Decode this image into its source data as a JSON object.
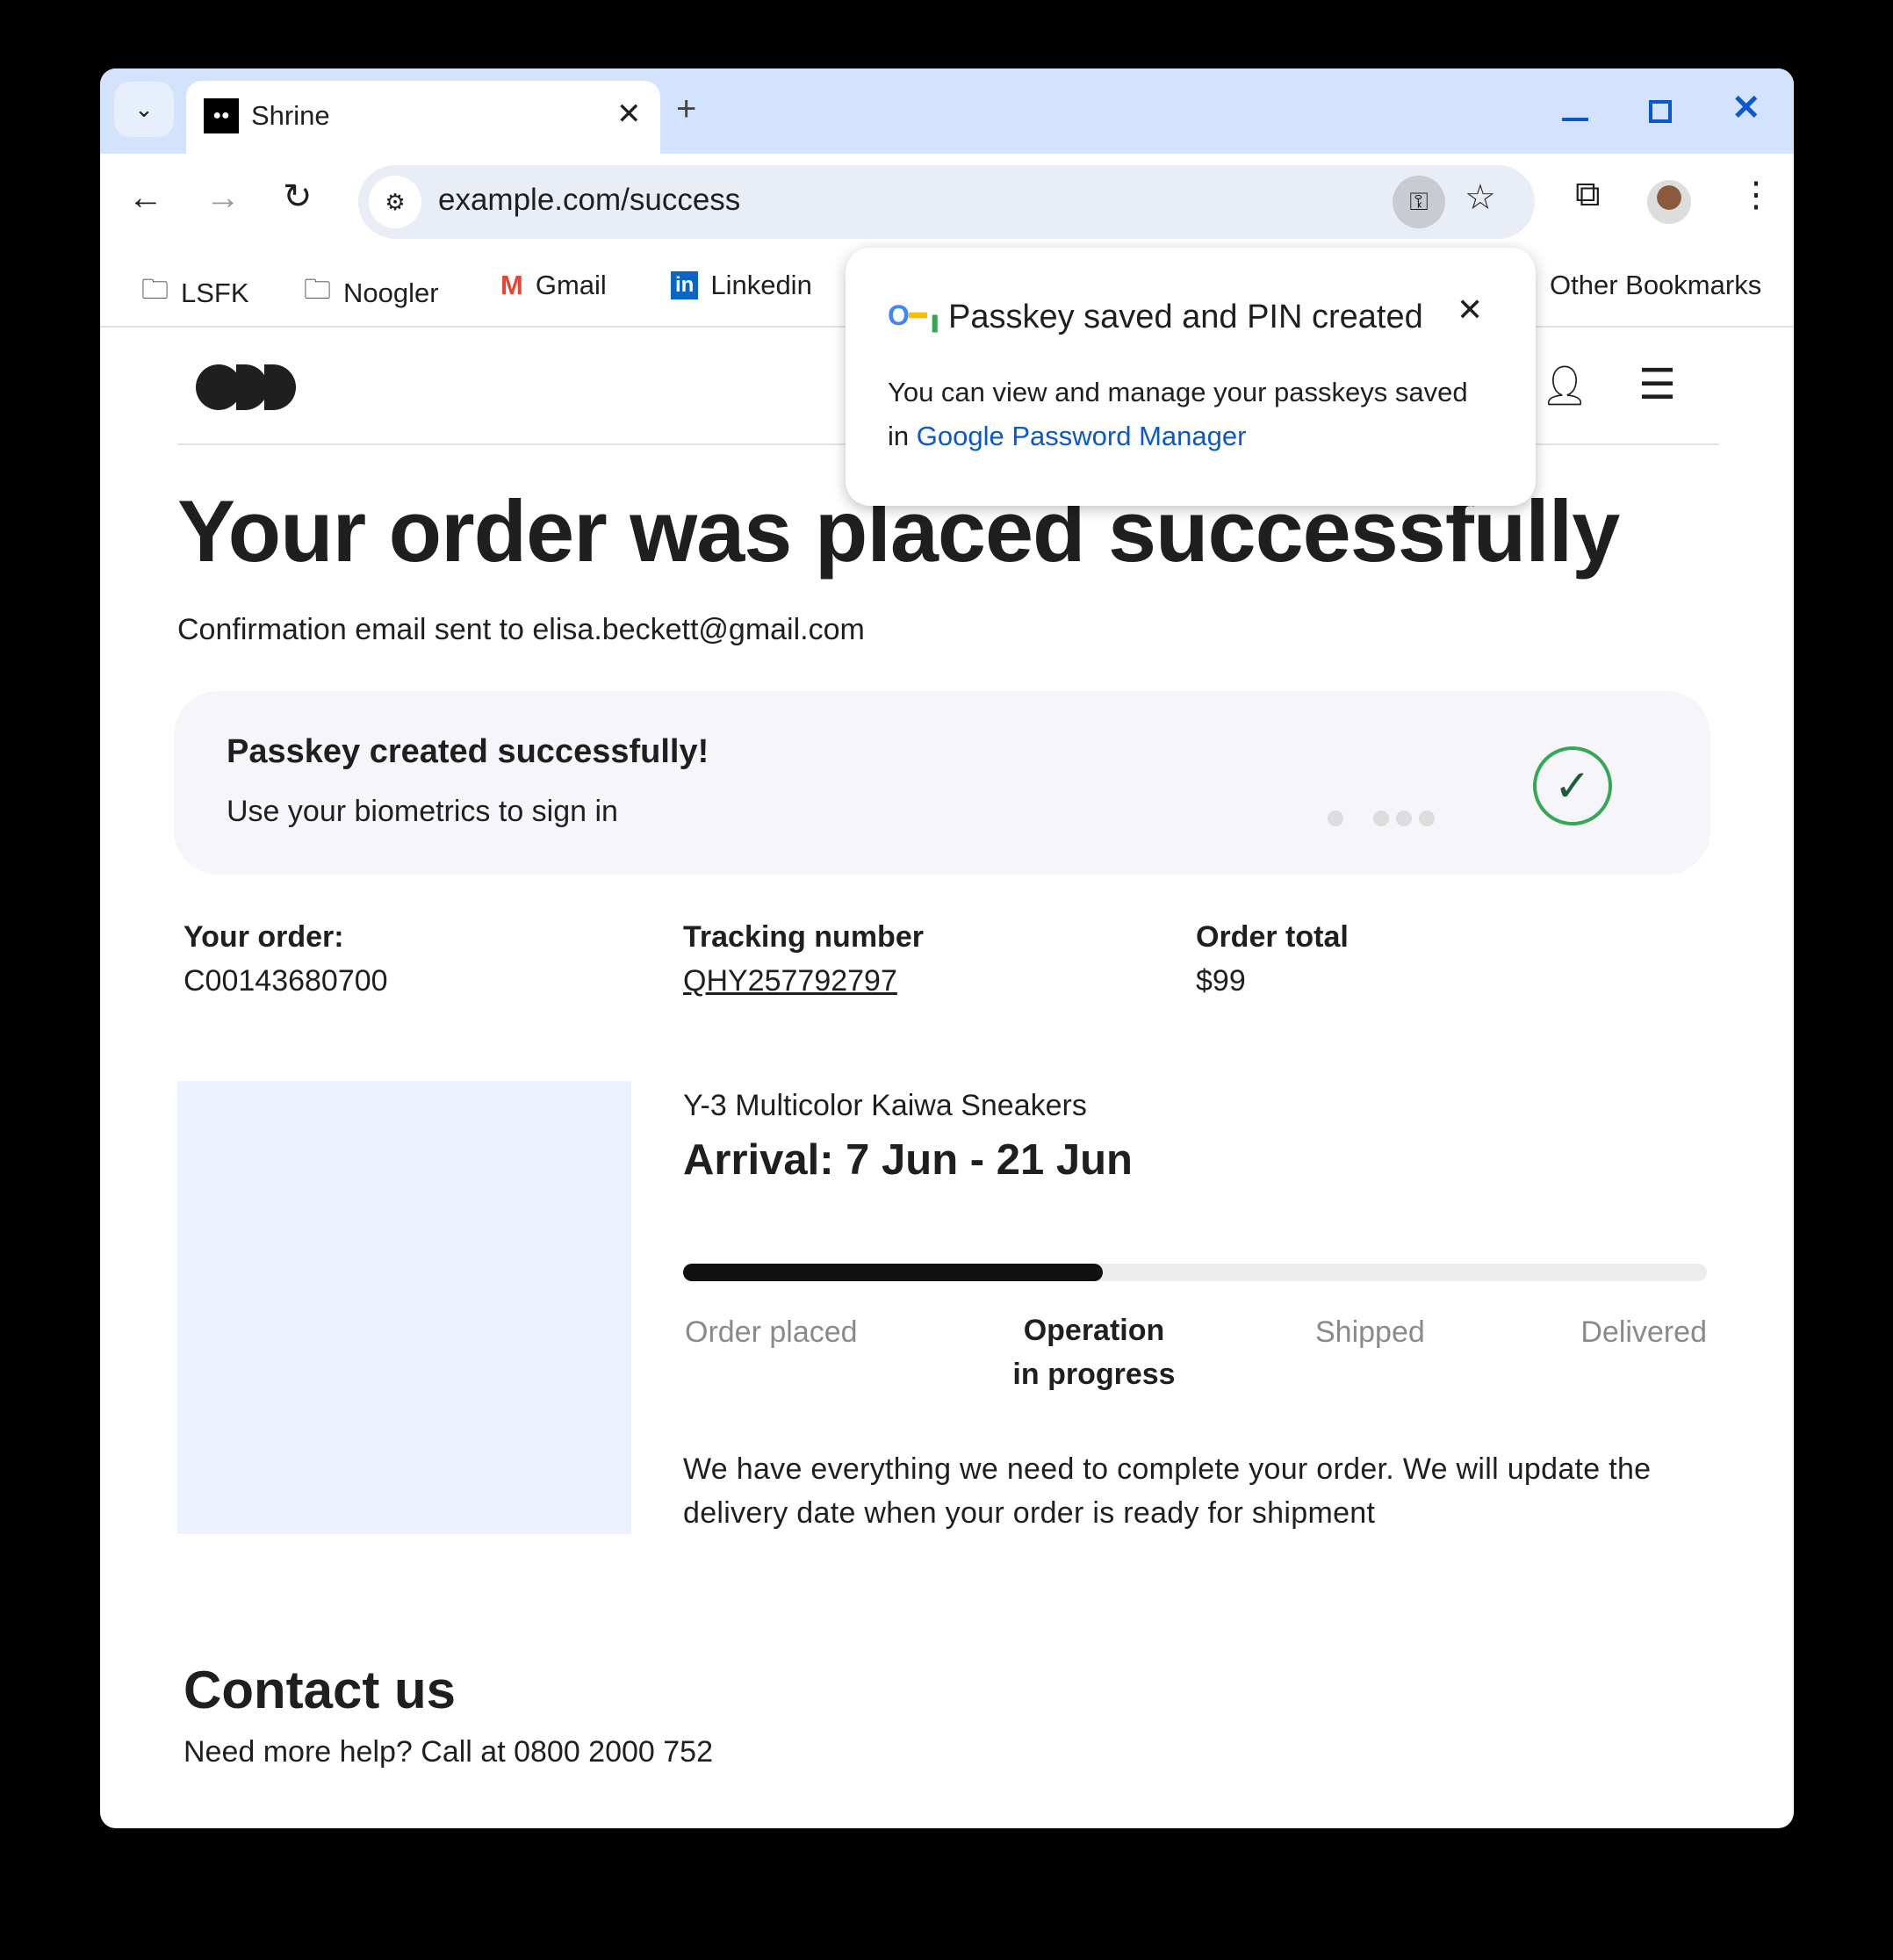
{
  "browser": {
    "tab_title": "Shrine",
    "url": "example.com/success",
    "bookmarks": [
      {
        "label": "LSFK",
        "icon": "folder-icon"
      },
      {
        "label": "Noogler",
        "icon": "folder-icon"
      },
      {
        "label": "Gmail",
        "icon": "gmail-icon"
      },
      {
        "label": "Linkedin",
        "icon": "linkedin-icon"
      }
    ],
    "other_bookmarks": "Other Bookmarks"
  },
  "popup": {
    "title": "Passkey saved and PIN created",
    "body": "You can view and manage your passkeys saved",
    "body_prefix": "in",
    "link": "Google Password Manager"
  },
  "page": {
    "heading": "Your order was placed successfully",
    "confirmation": "Confirmation email sent to elisa.beckett@gmail.com",
    "passkey_card": {
      "title": "Passkey created successfully!",
      "subtitle": "Use your biometrics to sign in",
      "accent": "#34a853"
    },
    "order": {
      "order_label": "Your order:",
      "order_value": "C00143680700",
      "tracking_label": "Tracking number",
      "tracking_value": "QHY257792797",
      "total_label": "Order total",
      "total_value": "$99"
    },
    "product": {
      "name": "Y-3 Multicolor Kaiwa Sneakers",
      "arrival": "Arrival: 7 Jun - 21 Jun",
      "progress_percent": 41,
      "steps": [
        "Order placed",
        "Operation in progress",
        "Shipped",
        "Delivered"
      ],
      "current_step": 1,
      "description": "We have everything we need to complete your order. We will update the delivery date when your order is ready for shipment"
    },
    "contact": {
      "title": "Contact us",
      "text": "Need more help? Call at 0800 2000 752"
    }
  }
}
